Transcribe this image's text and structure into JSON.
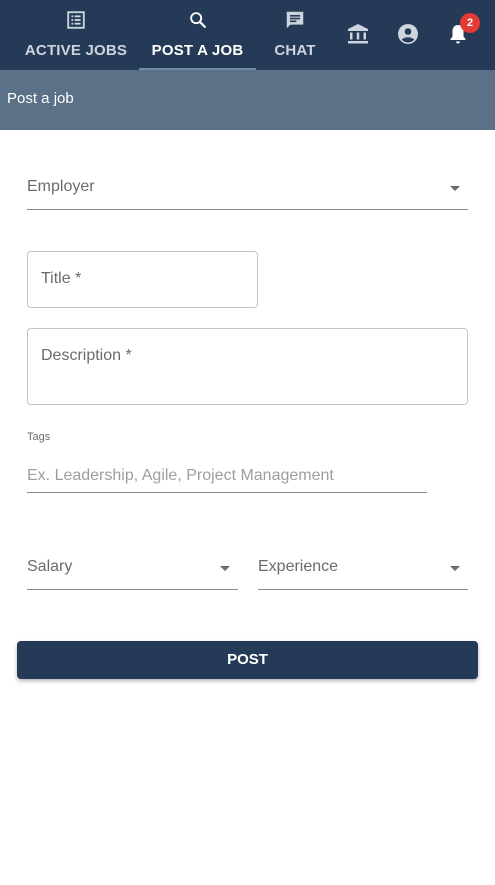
{
  "tabs": [
    {
      "label": "ACTIVE JOBS",
      "icon": "list-icon"
    },
    {
      "label": "POST A JOB",
      "icon": "search-icon"
    },
    {
      "label": "CHAT",
      "icon": "chat-icon"
    }
  ],
  "active_tab": "POST A JOB",
  "header_icons": [
    "bank-icon",
    "account-circle-icon",
    "bell-icon"
  ],
  "notifications": {
    "count": "2"
  },
  "subheader": {
    "title": "Post a job"
  },
  "form": {
    "employer_label": "Employer",
    "title_label": "Title *",
    "description_label": "Description *",
    "tags_label": "Tags",
    "tags_placeholder": "Ex. Leadership, Agile, Project Management",
    "salary_label": "Salary",
    "experience_label": "Experience",
    "submit_label": "POST"
  },
  "colors": {
    "nav_background": "#253a56",
    "subheader_background": "#5a7187",
    "badge": "#e53935",
    "button": "#253a56"
  }
}
